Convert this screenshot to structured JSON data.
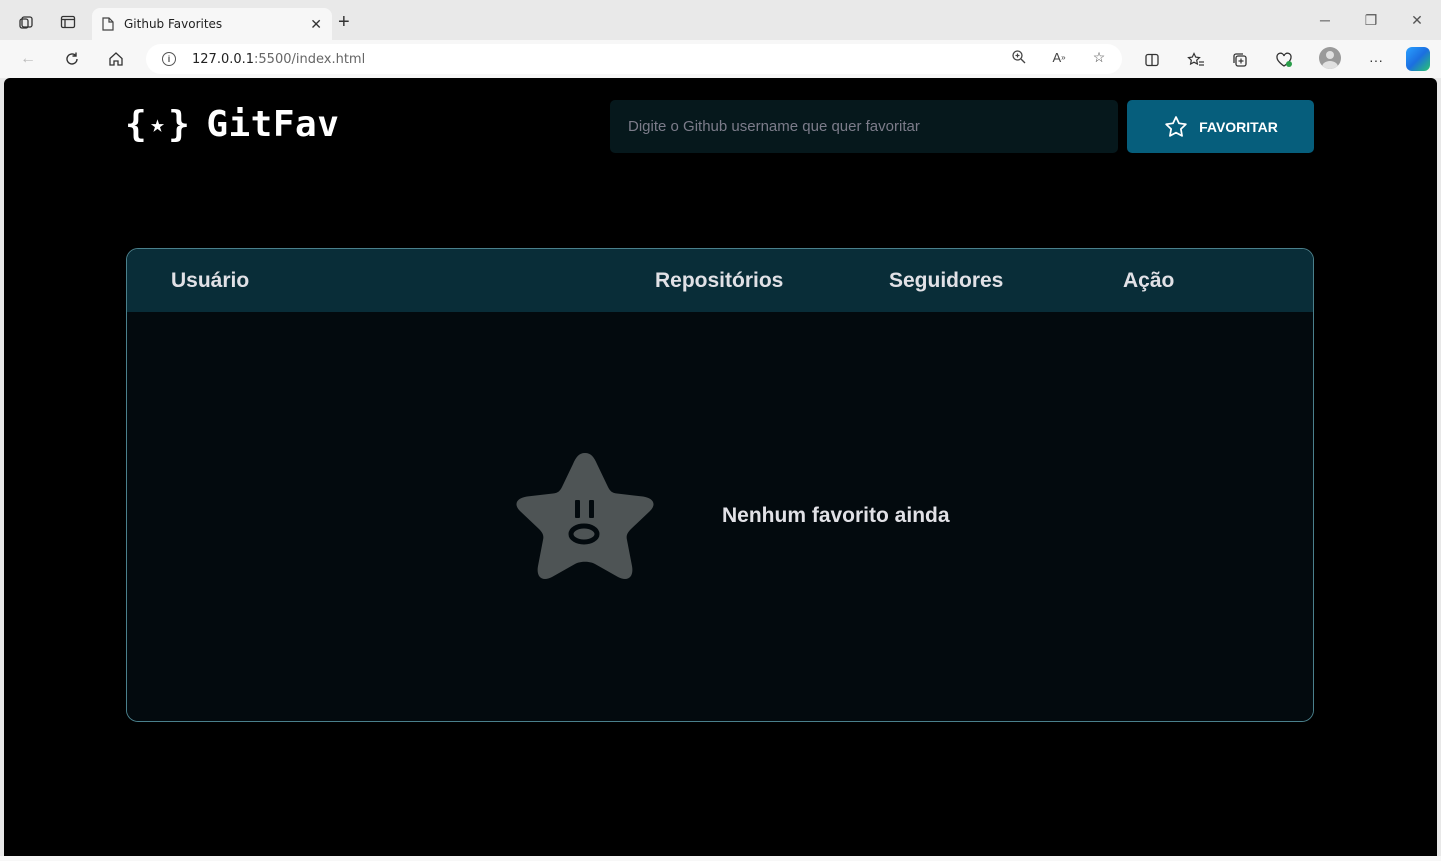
{
  "browser": {
    "tab_title": "Github Favorites",
    "url_host": "127.0.0.1",
    "url_path": ":5500/index.html"
  },
  "app": {
    "logo_name": "GitFav",
    "search": {
      "placeholder": "Digite o Github username que quer favoritar",
      "value": ""
    },
    "favorite_button_label": "FAVORITAR"
  },
  "table": {
    "columns": [
      "Usuário",
      "Repositórios",
      "Seguidores",
      "Ação"
    ],
    "rows": [],
    "empty_message": "Nenhum favorito ainda"
  },
  "colors": {
    "page_bg": "#000000",
    "input_bg": "#06181C",
    "button_bg": "#065E7C",
    "table_header_bg": "#092D38",
    "table_body_bg": "#030A0E",
    "table_border": "#4A808C",
    "text": "#E1E1E6",
    "empty_star": "#4E5455"
  },
  "icons": {
    "logo": "star-in-braces-icon",
    "button": "star-outline-icon",
    "empty_state": "surprised-star-icon"
  }
}
